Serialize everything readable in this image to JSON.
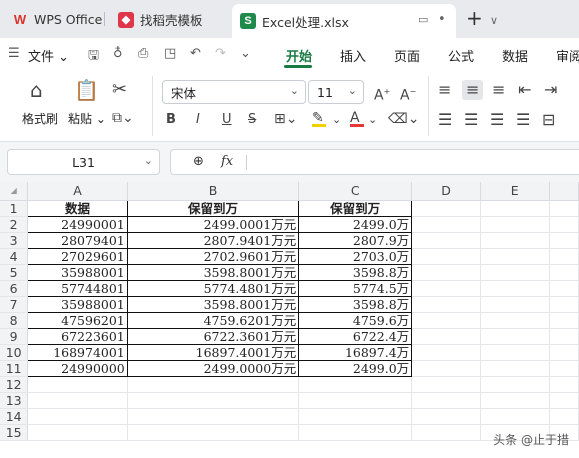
{
  "tabs": [
    {
      "label": "WPS Office",
      "icon": "wps-logo-icon",
      "color": "#d9342b"
    },
    {
      "label": "找稻壳模板",
      "icon": "docer-icon",
      "color": "#e0364a"
    },
    {
      "label": "Excel处理.xlsx",
      "icon": "spreadsheet-s-icon",
      "color": "#1f8a4c",
      "active": true
    }
  ],
  "menu": {
    "file_label": "文件",
    "tabs": [
      "开始",
      "插入",
      "页面",
      "公式",
      "数据",
      "审阅"
    ],
    "active_tab": "开始"
  },
  "ribbon": {
    "format_painter_label": "格式刷",
    "paste_label": "粘贴",
    "font_name": "宋体",
    "font_size": "11",
    "bold": "B",
    "italic": "I",
    "underline": "U",
    "strike": "S",
    "font_color": "#e53935",
    "highlight_color": "#f5d000"
  },
  "formula_bar": {
    "name_box": "L31",
    "fx_label": "fx",
    "formula_value": ""
  },
  "sheet": {
    "columns": [
      "A",
      "B",
      "C",
      "D",
      "E"
    ],
    "rows": [
      "1",
      "2",
      "3",
      "4",
      "5",
      "6",
      "7",
      "8",
      "9",
      "10",
      "11",
      "12",
      "13",
      "14",
      "15"
    ],
    "headers": [
      "数据",
      "保留到万",
      "保留到万"
    ],
    "data": [
      [
        "24990001",
        "2499.0001万元",
        "2499.0万"
      ],
      [
        "28079401",
        "2807.9401万元",
        "2807.9万"
      ],
      [
        "27029601",
        "2702.9601万元",
        "2703.0万"
      ],
      [
        "35988001",
        "3598.8001万元",
        "3598.8万"
      ],
      [
        "57744801",
        "5774.4801万元",
        "5774.5万"
      ],
      [
        "35988001",
        "3598.8001万元",
        "3598.8万"
      ],
      [
        "47596201",
        "4759.6201万元",
        "4759.6万"
      ],
      [
        "67223601",
        "6722.3601万元",
        "6722.4万"
      ],
      [
        "168974001",
        "16897.4001万元",
        "16897.4万"
      ],
      [
        "24990000",
        "2499.0000万元",
        "2499.0万"
      ]
    ]
  },
  "watermark": "头条 @止于措"
}
